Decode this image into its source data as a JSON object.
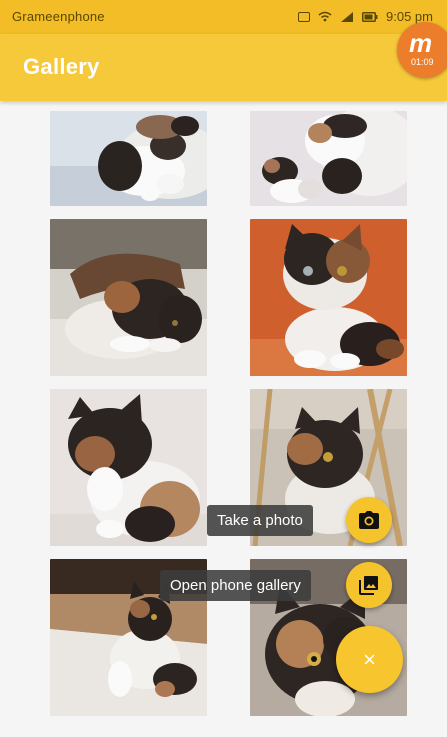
{
  "status_bar": {
    "carrier": "Grameenphone",
    "time": "9:05 pm"
  },
  "app_bar": {
    "title": "Gallery"
  },
  "overlay_badge": {
    "letter": "m",
    "time": "01:09"
  },
  "gallery": {
    "items": [
      {
        "bg": "#dfe6ee",
        "cat": "calico-lying"
      },
      {
        "bg": "#ebe6ea",
        "cat": "two-kittens"
      },
      {
        "bg": "#d9d6cf",
        "cat": "calico-lounging"
      },
      {
        "bg": "#d4622f",
        "cat": "calico-sitting"
      },
      {
        "bg": "#ede8e6",
        "cat": "cat-paw-up"
      },
      {
        "bg": "#cfc6bb",
        "cat": "cat-in-chair"
      },
      {
        "bg": "#e9e4de",
        "cat": "cat-on-stairs"
      },
      {
        "bg": "#b9afa4",
        "cat": "cat-closeup"
      }
    ]
  },
  "fab_menu": {
    "take_photo_label": "Take a photo",
    "open_gallery_label": "Open phone gallery",
    "close_symbol": "×"
  },
  "colors": {
    "status_bar": "#f2bd27",
    "app_bar": "#f6c93a",
    "fab": "#f7c52e",
    "label_bg": "#3c3c3c"
  },
  "icons": [
    "camera-icon",
    "photo-library-icon",
    "close-icon",
    "wifi-icon",
    "signal-icon",
    "battery-icon"
  ]
}
